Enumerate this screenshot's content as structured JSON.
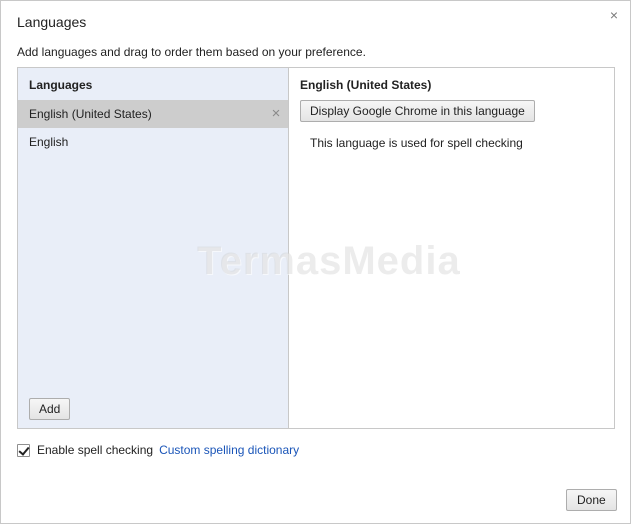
{
  "dialog": {
    "title": "Languages",
    "close_glyph": "×",
    "subtitle": "Add languages and drag to order them based on your preference."
  },
  "left_pane": {
    "header": "Languages",
    "items": [
      {
        "label": "English (United States)",
        "selected": true,
        "remove_glyph": "×"
      },
      {
        "label": "English",
        "selected": false
      }
    ],
    "add_label": "Add"
  },
  "right_pane": {
    "header": "English (United States)",
    "display_button_label": "Display Google Chrome in this language",
    "spell_note": "This language is used for spell checking"
  },
  "watermark": "TermasMedia",
  "footer": {
    "spell_check_label": "Enable spell checking",
    "spell_check_checked": true,
    "custom_dictionary_link": "Custom spelling dictionary",
    "done_label": "Done"
  },
  "colors": {
    "left_pane_bg": "#e9eef8",
    "selected_row_bg": "#cdcdcd",
    "link": "#1a55b8",
    "border": "#c8c8c8"
  },
  "icons": {
    "close": "close-icon",
    "remove": "remove-icon",
    "checkbox": "checkmark-icon"
  }
}
